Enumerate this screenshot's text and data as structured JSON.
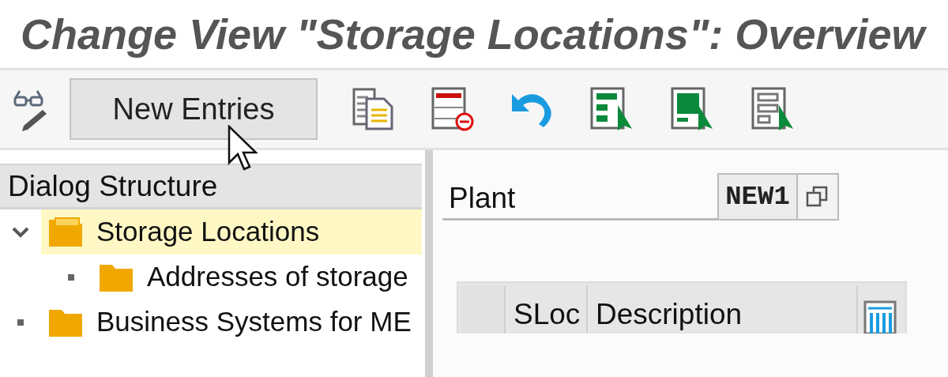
{
  "window": {
    "title": "Change View \"Storage Locations\": Overview"
  },
  "toolbar": {
    "buttons": [
      {
        "kind": "glasses"
      },
      {
        "kind": "text",
        "label": "New Entries"
      },
      {
        "kind": "copy"
      },
      {
        "kind": "delete"
      },
      {
        "kind": "undo"
      },
      {
        "kind": "select-all"
      },
      {
        "kind": "select-block"
      },
      {
        "kind": "deselect-all"
      }
    ]
  },
  "dialog_structure": {
    "title": "Dialog Structure",
    "items": [
      {
        "label": "Storage Locations",
        "selected": true,
        "expanded": true,
        "children": [
          {
            "label": "Addresses of storage",
            "selected": false
          }
        ]
      },
      {
        "label": "Business Systems for ME",
        "selected": false
      }
    ]
  },
  "plant": {
    "label": "Plant",
    "value": "NEW1"
  },
  "table": {
    "columns": [
      "SLoc",
      "Description"
    ]
  }
}
